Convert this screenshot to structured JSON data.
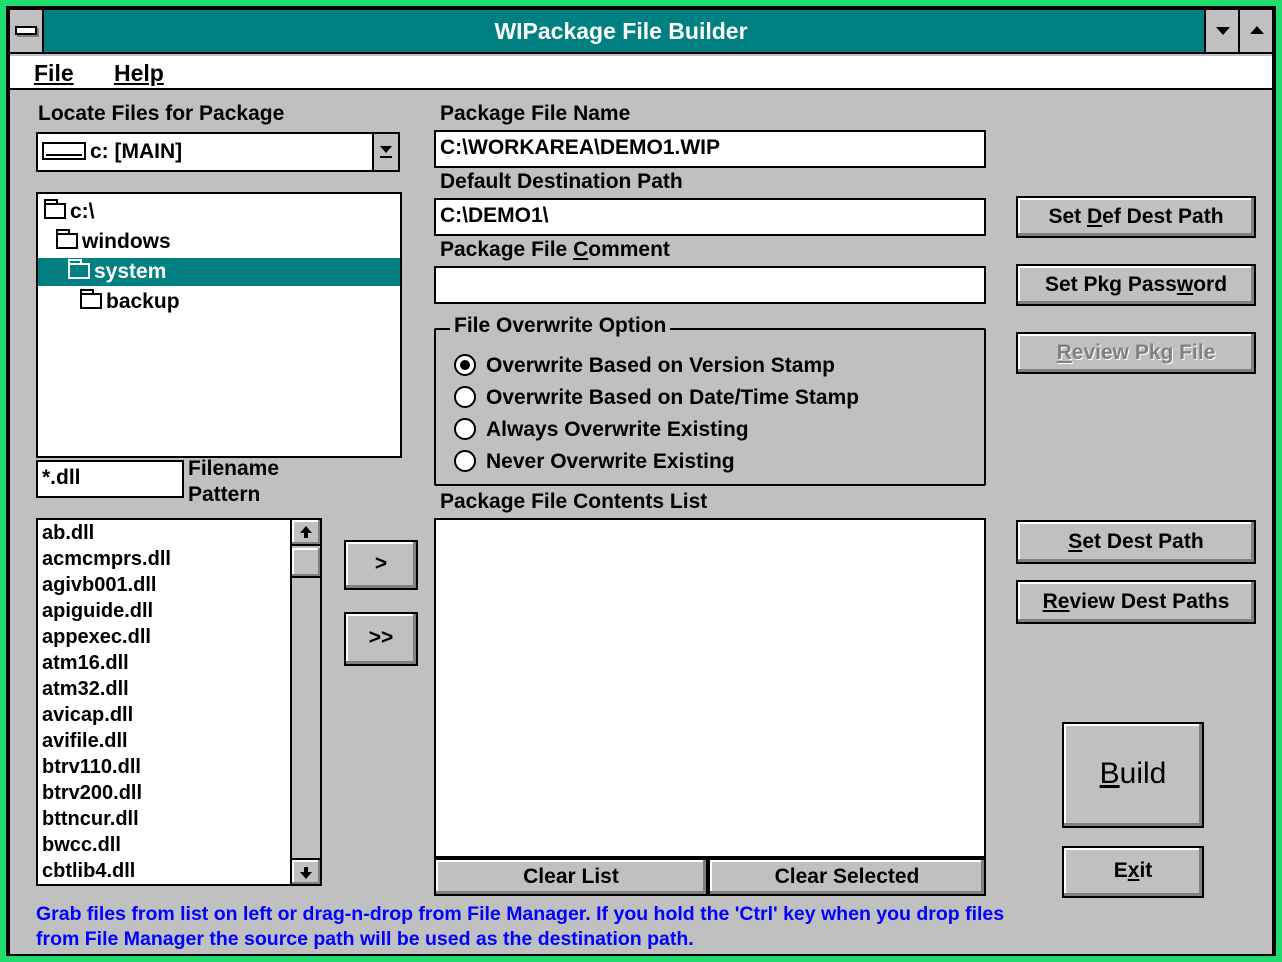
{
  "window": {
    "title": "WIPackage File Builder"
  },
  "menubar": {
    "file": "File",
    "help": "Help"
  },
  "locate": {
    "label": "Locate Files for Package",
    "drive": "c: [MAIN]"
  },
  "tree": {
    "items": [
      {
        "label": "c:\\",
        "state": "open"
      },
      {
        "label": "windows",
        "state": "open"
      },
      {
        "label": "system",
        "state": "open",
        "selected": true
      },
      {
        "label": "backup",
        "state": "closed"
      }
    ]
  },
  "filter": {
    "value": "*.dll",
    "label_line1": "Filename",
    "label_line2": "Pattern"
  },
  "source_files": [
    "ab.dll",
    "acmcmprs.dll",
    "agivb001.dll",
    "apiguide.dll",
    "appexec.dll",
    "atm16.dll",
    "atm32.dll",
    "avicap.dll",
    "avifile.dll",
    "btrv110.dll",
    "btrv200.dll",
    "bttncur.dll",
    "bwcc.dll",
    "cbtlib4.dll"
  ],
  "transfer": {
    "add_one": ">",
    "add_all": ">>"
  },
  "package": {
    "name_label": "Package File Name",
    "name_value": "C:\\WORKAREA\\DEMO1.WIP",
    "dest_label": "Default Destination Path",
    "dest_value": "C:\\DEMO1\\",
    "comment_label_pre": "Package File ",
    "comment_label_u": "C",
    "comment_label_post": "omment",
    "comment_value": ""
  },
  "overwrite": {
    "title": "File Overwrite Option",
    "options": [
      {
        "label": "Overwrite Based on Version Stamp",
        "checked": true
      },
      {
        "label": "Overwrite Based on Date/Time Stamp",
        "checked": false
      },
      {
        "label": "Always Overwrite Existing",
        "checked": false
      },
      {
        "label": "Never Overwrite Existing",
        "checked": false
      }
    ]
  },
  "contents": {
    "label": "Package File Contents List",
    "items": [],
    "clear_list": "Clear List",
    "clear_selected": "Clear Selected"
  },
  "buttons": {
    "set_def_dest_pre": "Set ",
    "set_def_dest_u": "D",
    "set_def_dest_post": "ef Dest Path",
    "set_pwd_pre": "Set Pkg Pass",
    "set_pwd_u": "w",
    "set_pwd_post": "ord",
    "review_pkg_u": "R",
    "review_pkg_post": "eview Pkg File",
    "set_dest_u": "S",
    "set_dest_post": "et Dest Path",
    "review_dest_u": "R",
    "review_dest_u2": "e",
    "review_dest_post": "view Dest Paths",
    "build_u": "B",
    "build_post": "uild",
    "exit_pre": "E",
    "exit_u": "x",
    "exit_post": "it"
  },
  "hint": {
    "line1": "Grab files from list on left or drag-n-drop from File Manager.  If you hold the 'Ctrl' key when you drop files",
    "line2": "from File Manager the source path will be used as the destination path."
  },
  "colors": {
    "titlebar": "#008080",
    "selection": "#008080",
    "face": "#c0c0c0",
    "hint": "#0000ff",
    "outer_frame": "#1edc6e"
  }
}
